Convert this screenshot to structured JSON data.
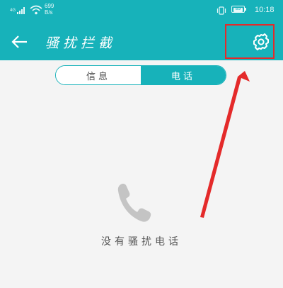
{
  "status_bar": {
    "signal_label": "4G",
    "net_speed": "699 B/s",
    "battery_percent": "89",
    "time": "10:18"
  },
  "header": {
    "title": "骚扰拦截"
  },
  "tabs": [
    {
      "label": "信息",
      "selected": false
    },
    {
      "label": "电话",
      "selected": true
    }
  ],
  "empty_state": {
    "message": "没有骚扰电话",
    "icon": "phone-icon"
  },
  "colors": {
    "accent": "#17b2ba",
    "annotation_red": "#e42a2a",
    "background": "#f4f4f4"
  },
  "icons": {
    "back": "arrow-left-icon",
    "settings": "gear-icon"
  }
}
